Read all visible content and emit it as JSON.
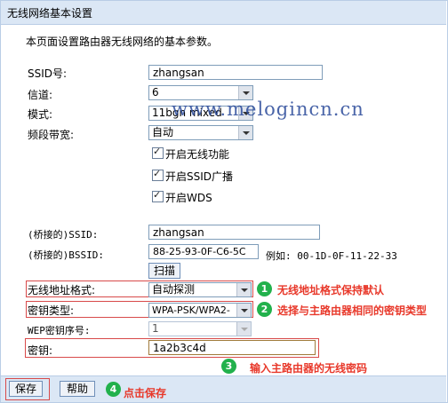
{
  "title": "无线网络基本设置",
  "intro": "本页面设置路由器无线网络的基本参数。",
  "fields": {
    "ssid_label": "SSID号:",
    "ssid_value": "zhangsan",
    "channel_label": "信道:",
    "channel_value": "6",
    "mode_label": "模式:",
    "mode_value": "11bgn mixed",
    "bandwidth_label": "频段带宽:",
    "bandwidth_value": "自动",
    "wireless_label": "开启无线功能",
    "ssid_broadcast_label": "开启SSID广播",
    "wds_label": "开启WDS",
    "bridge_ssid_label": "(桥接的)SSID:",
    "bridge_ssid_value": "zhangsan",
    "bridge_bssid_label": "(桥接的)BSSID:",
    "bridge_bssid_value": "88-25-93-0F-C6-5C",
    "bssid_example": "例如: 00-1D-0F-11-22-33",
    "scan_label": "扫描",
    "addr_format_label": "无线地址格式:",
    "addr_format_value": "自动探测",
    "key_type_label": "密钥类型:",
    "key_type_value": "WPA-PSK/WPA2-",
    "wep_index_label": "WEP密钥序号:",
    "wep_index_value": "1",
    "key_label": "密钥:",
    "key_value": "1a2b3c4d"
  },
  "annotations": {
    "a1_num": "1",
    "a1_text": "无线地址格式保持默认",
    "a2_num": "2",
    "a2_text": "选择与主路由器相同的密钥类型",
    "a3_num": "3",
    "a3_text": "输入主路由器的无线密码",
    "a4_num": "4",
    "a4_text": "点击保存"
  },
  "buttons": {
    "save": "保存",
    "help": "帮助"
  },
  "watermark": "www.melogincn.cn",
  "colors": {
    "header_bg": "#dbe7f5",
    "annotation_red": "#e8382a",
    "badge_green": "#22b14c"
  }
}
